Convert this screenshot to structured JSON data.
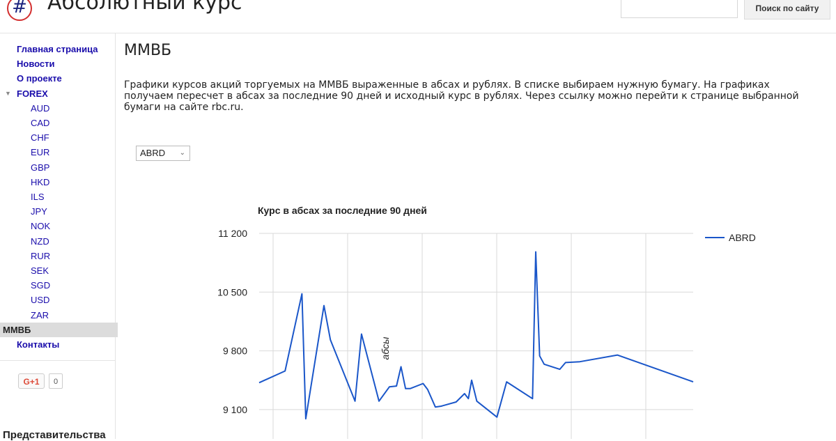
{
  "site": {
    "logo_glyph": "#",
    "title": "Абсолютный курс",
    "search_placeholder": "",
    "search_button": "Поиск по сайту"
  },
  "sidebar": {
    "items": [
      {
        "label": "Главная страница",
        "kind": "top"
      },
      {
        "label": "Новости",
        "kind": "top"
      },
      {
        "label": "О проекте",
        "kind": "top"
      },
      {
        "label": "FOREX",
        "kind": "top",
        "expanded": true
      },
      {
        "label": "AUD",
        "kind": "sub"
      },
      {
        "label": "CAD",
        "kind": "sub"
      },
      {
        "label": "CHF",
        "kind": "sub"
      },
      {
        "label": "EUR",
        "kind": "sub"
      },
      {
        "label": "GBP",
        "kind": "sub"
      },
      {
        "label": "HKD",
        "kind": "sub"
      },
      {
        "label": "ILS",
        "kind": "sub"
      },
      {
        "label": "JPY",
        "kind": "sub"
      },
      {
        "label": "NOK",
        "kind": "sub"
      },
      {
        "label": "NZD",
        "kind": "sub"
      },
      {
        "label": "RUR",
        "kind": "sub"
      },
      {
        "label": "SEK",
        "kind": "sub"
      },
      {
        "label": "SGD",
        "kind": "sub"
      },
      {
        "label": "USD",
        "kind": "sub"
      },
      {
        "label": "ZAR",
        "kind": "sub"
      },
      {
        "label": "ММВБ",
        "kind": "active"
      },
      {
        "label": "Контакты",
        "kind": "top"
      }
    ],
    "gplus_label": "G+1",
    "gplus_count": "0",
    "representations": "Представительства"
  },
  "main": {
    "title": "ММВБ",
    "description": "Графики курсов акций торгуемых на ММВБ выраженные в абсах и рублях. В списке выбираем нужную бумагу. На графиках получаем пересчет в абсах за последние 90 дней и исходный курс в рублях. Через ссылку можно перейти к странице выбранной бумаги на сайте rbc.ru.",
    "select_value": "ABRD"
  },
  "colors": {
    "line": "#1a56c9",
    "grid": "#d9d9d9",
    "link": "#1a0dab"
  },
  "chart_data": {
    "type": "line",
    "title": "Курс в абсах за последние 90 дней",
    "ylabel": "абсы",
    "xlabel": "",
    "yticks": [
      9100,
      9800,
      10500,
      11200
    ],
    "ytick_labels": [
      "9 100",
      "9 800",
      "10 500",
      "11 200"
    ],
    "ylim": [
      8750,
      11200
    ],
    "legend_position": "top-right",
    "grid": true,
    "series": [
      {
        "name": "ABRD",
        "x": [
          0,
          4,
          6.6,
          7.2,
          10,
          11,
          14.8,
          15.8,
          18.5,
          20.1,
          21.2,
          21.9,
          22.6,
          23.3,
          25.3,
          26,
          27.2,
          28.1,
          30.4,
          31.7,
          32.3,
          32.8,
          33.6,
          36.7,
          38.2,
          42.2,
          42.7,
          43.3,
          44,
          46.4,
          47.3,
          49.5,
          55.3,
          67
        ],
        "y": [
          9420,
          9560,
          10480,
          8990,
          10340,
          9930,
          9200,
          10000,
          9200,
          9370,
          9380,
          9610,
          9350,
          9350,
          9410,
          9340,
          9130,
          9140,
          9190,
          9290,
          9230,
          9450,
          9200,
          9010,
          9430,
          9230,
          10980,
          9740,
          9640,
          9580,
          9660,
          9670,
          9750,
          9430
        ]
      }
    ]
  }
}
